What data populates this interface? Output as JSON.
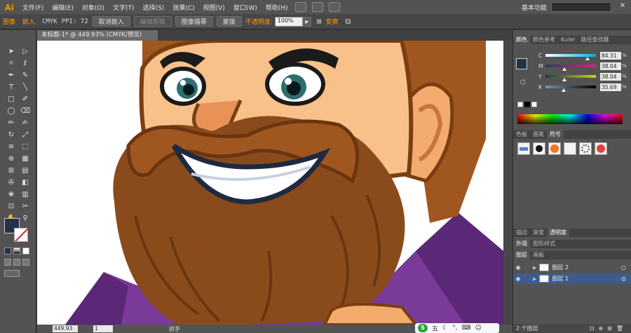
{
  "app": {
    "logo": "Ai",
    "workspace": "基本功能"
  },
  "menu": [
    "文件(F)",
    "编辑(E)",
    "对象(O)",
    "文字(T)",
    "选择(S)",
    "效果(C)",
    "视图(V)",
    "窗口(W)",
    "帮助(H)"
  ],
  "controlbar": {
    "label": "图像",
    "embedded": "嵌入",
    "colormode": "CMYK",
    "ppi": "PPI: 72",
    "unembed": "取消嵌入",
    "edit_original": "编辑原稿",
    "image_trace": "图像描摹",
    "mask": "蒙版",
    "opacity_label": "不透明度:",
    "opacity_value": "100%",
    "transform": "变换"
  },
  "document": {
    "tab_title": "未标题-1* @ 449.93% (CMYK/预览)",
    "zoom": "449.93",
    "page": "1",
    "status": "抓手"
  },
  "color_panel": {
    "tabs": [
      "颜色",
      "颜色参考",
      "Kuler",
      "路径查找器"
    ],
    "sliders": [
      {
        "label": "C",
        "value": "84.31",
        "fraction": 0.84,
        "gradient": "linear-gradient(to right,#ffffff,#00aeef)"
      },
      {
        "label": "M",
        "value": "38.04",
        "fraction": 0.38,
        "gradient": "linear-gradient(to right,#274050,#e0208c)"
      },
      {
        "label": "Y",
        "value": "38.04",
        "fraction": 0.38,
        "gradient": "linear-gradient(to right,#1e3a46,#ccd400)"
      },
      {
        "label": "K",
        "value": "35.69",
        "fraction": 0.36,
        "gradient": "linear-gradient(to right,#6a9ab0,#000000)"
      }
    ],
    "pct": "%"
  },
  "swatch_panel": {
    "tabs": [
      "色板",
      "画笔",
      "符号"
    ]
  },
  "appearance_panel": {
    "tabs": [
      "描边",
      "渐变",
      "透明度"
    ],
    "tabs2": [
      "外观",
      "图形样式"
    ]
  },
  "layers_panel": {
    "tabs": [
      "图层",
      "画板"
    ],
    "layers": [
      {
        "name": "图层 2"
      },
      {
        "name": "图层 1"
      }
    ],
    "count": "2 个图层"
  },
  "ime": {
    "label": "五"
  },
  "colors": {
    "fill": "#233247",
    "accent": "#ff9a00"
  }
}
